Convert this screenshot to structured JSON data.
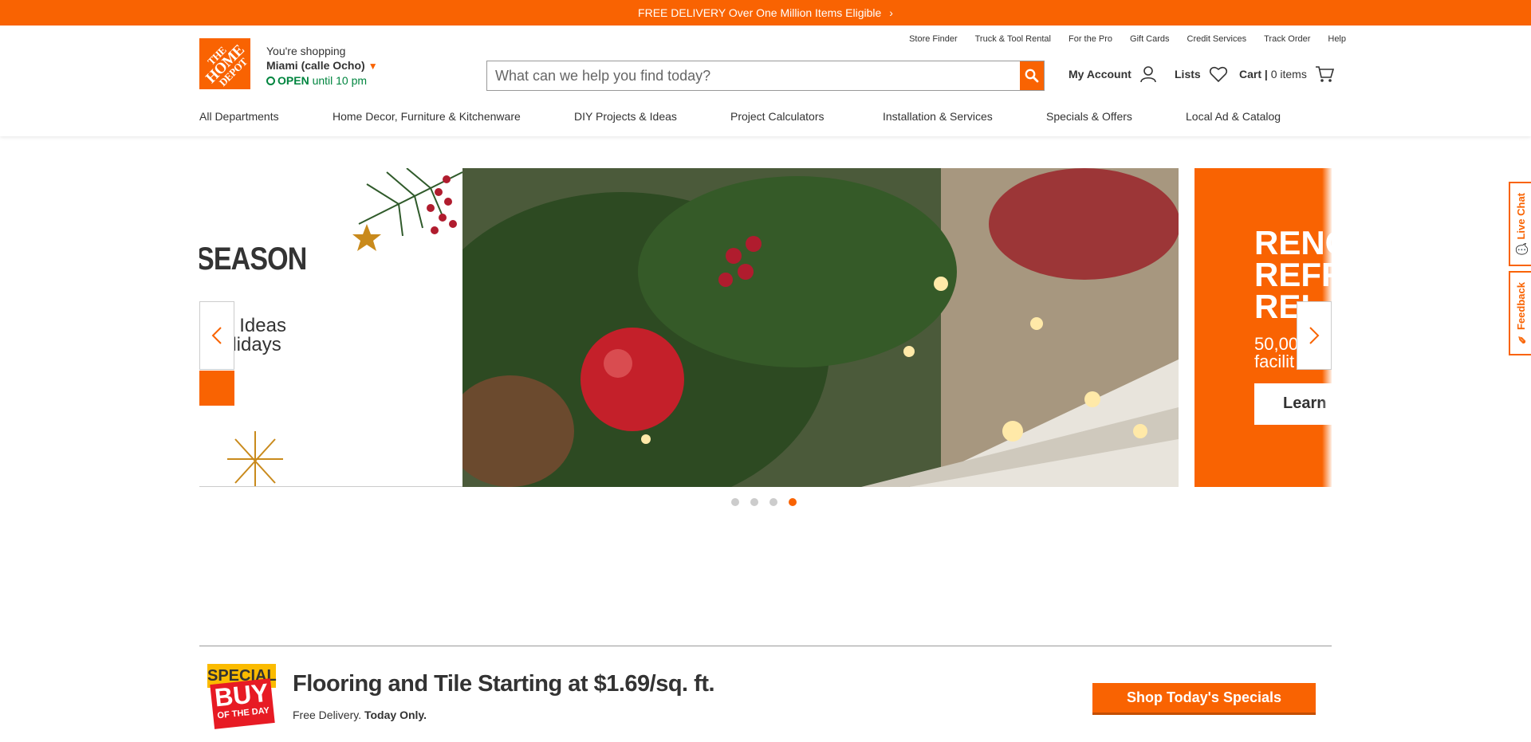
{
  "promo": {
    "text": "FREE DELIVERY Over One Million Items Eligible",
    "chevron": "chevron-right-icon"
  },
  "util_links": [
    "Store Finder",
    "Truck & Tool Rental",
    "For the Pro",
    "Gift Cards",
    "Credit Services",
    "Track Order",
    "Help"
  ],
  "logo": {
    "line1": "THE",
    "line2": "HOME",
    "line3": "DEPOT"
  },
  "store": {
    "label": "You're shopping",
    "name": "Miami (calle Ocho)",
    "open_status": "OPEN",
    "open_hours": "until 10 pm"
  },
  "search": {
    "placeholder": "What can we help you find today?"
  },
  "account": {
    "my_account": "My Account",
    "lists": "Lists",
    "cart": "Cart",
    "cart_items": "0 items"
  },
  "nav": [
    "All Departments",
    "Home Decor, Furniture & Kitchenware",
    "DIY Projects & Ideas",
    "Project Calculators",
    "Installation & Services",
    "Specials & Offers",
    "Local Ad & Catalog"
  ],
  "carousel": {
    "left_slide": {
      "title": "SEASON",
      "line1": "Y Ideas",
      "line2": "olidays"
    },
    "right_slide": {
      "line1": "RENO",
      "line2": "REFR",
      "line3": "REI",
      "sub1": "50,00",
      "sub2": "facilit",
      "button": "Learn"
    },
    "dots": 4,
    "active_dot": 4
  },
  "side_tabs": {
    "chat": "Live Chat",
    "feedback": "Feedback"
  },
  "special_buy": {
    "top": "SPECIAL",
    "buy": "BUY",
    "day": "OF THE DAY"
  },
  "deal": {
    "title": "Flooring and Tile Starting at $1.69/sq. ft.",
    "sub_plain": "Free Delivery.",
    "sub_bold": "Today Only.",
    "button": "Shop Today's Specials"
  },
  "colors": {
    "brand_orange": "#f96302",
    "open_green": "#00853f"
  }
}
